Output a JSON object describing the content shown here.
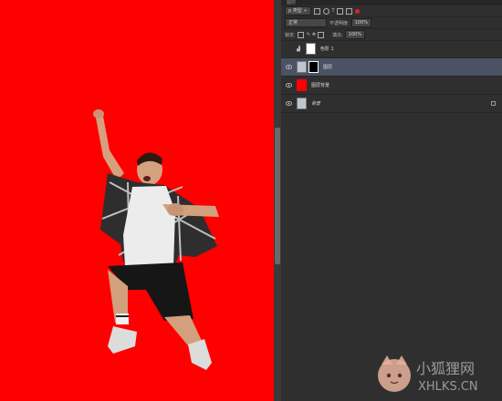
{
  "panel": {
    "tab_label": "图层",
    "filter_kind": "p 类型",
    "blend_mode": "正常",
    "opacity_label": "不透明度:",
    "opacity_value": "100%",
    "lock_label": "锁定:",
    "fill_label": "填充:",
    "fill_value": "100%"
  },
  "layers": [
    {
      "name": "色阶 1",
      "visible": false,
      "selected": false,
      "type": "adjustment"
    },
    {
      "name": "图层",
      "visible": true,
      "selected": true,
      "type": "masked"
    },
    {
      "name": "图层背景",
      "visible": true,
      "selected": false,
      "type": "color",
      "color": "#ff0000"
    },
    {
      "name": "背景",
      "visible": true,
      "selected": false,
      "type": "background",
      "locked": true
    }
  ],
  "watermark": {
    "cn": "小狐狸网",
    "en": "XHLKS.CN"
  },
  "colors": {
    "canvas_bg": "#ff0000",
    "panel_bg": "#2f2f2f",
    "selected_layer": "#4a5264"
  }
}
